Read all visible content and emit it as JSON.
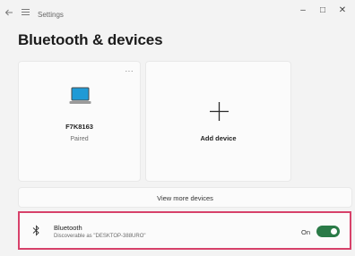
{
  "window": {
    "app_title": "Settings",
    "minimize_glyph": "–",
    "maximize_glyph": "□",
    "close_glyph": "✕"
  },
  "page": {
    "title": "Bluetooth & devices"
  },
  "devices": [
    {
      "name": "F7K8163",
      "status": "Paired",
      "icon": "laptop-icon",
      "menu_glyph": "···"
    }
  ],
  "add_device": {
    "label": "Add device",
    "icon": "plus-icon"
  },
  "view_more": {
    "label": "View more devices"
  },
  "bluetooth": {
    "title": "Bluetooth",
    "subtitle": "Discoverable as \"DESKTOP-388URO\"",
    "state_label": "On",
    "enabled": true,
    "icon": "bluetooth-icon"
  },
  "colors": {
    "accent": "#2a7a47",
    "highlight_border": "#d7416a",
    "laptop_screen": "#1f9ad6"
  }
}
